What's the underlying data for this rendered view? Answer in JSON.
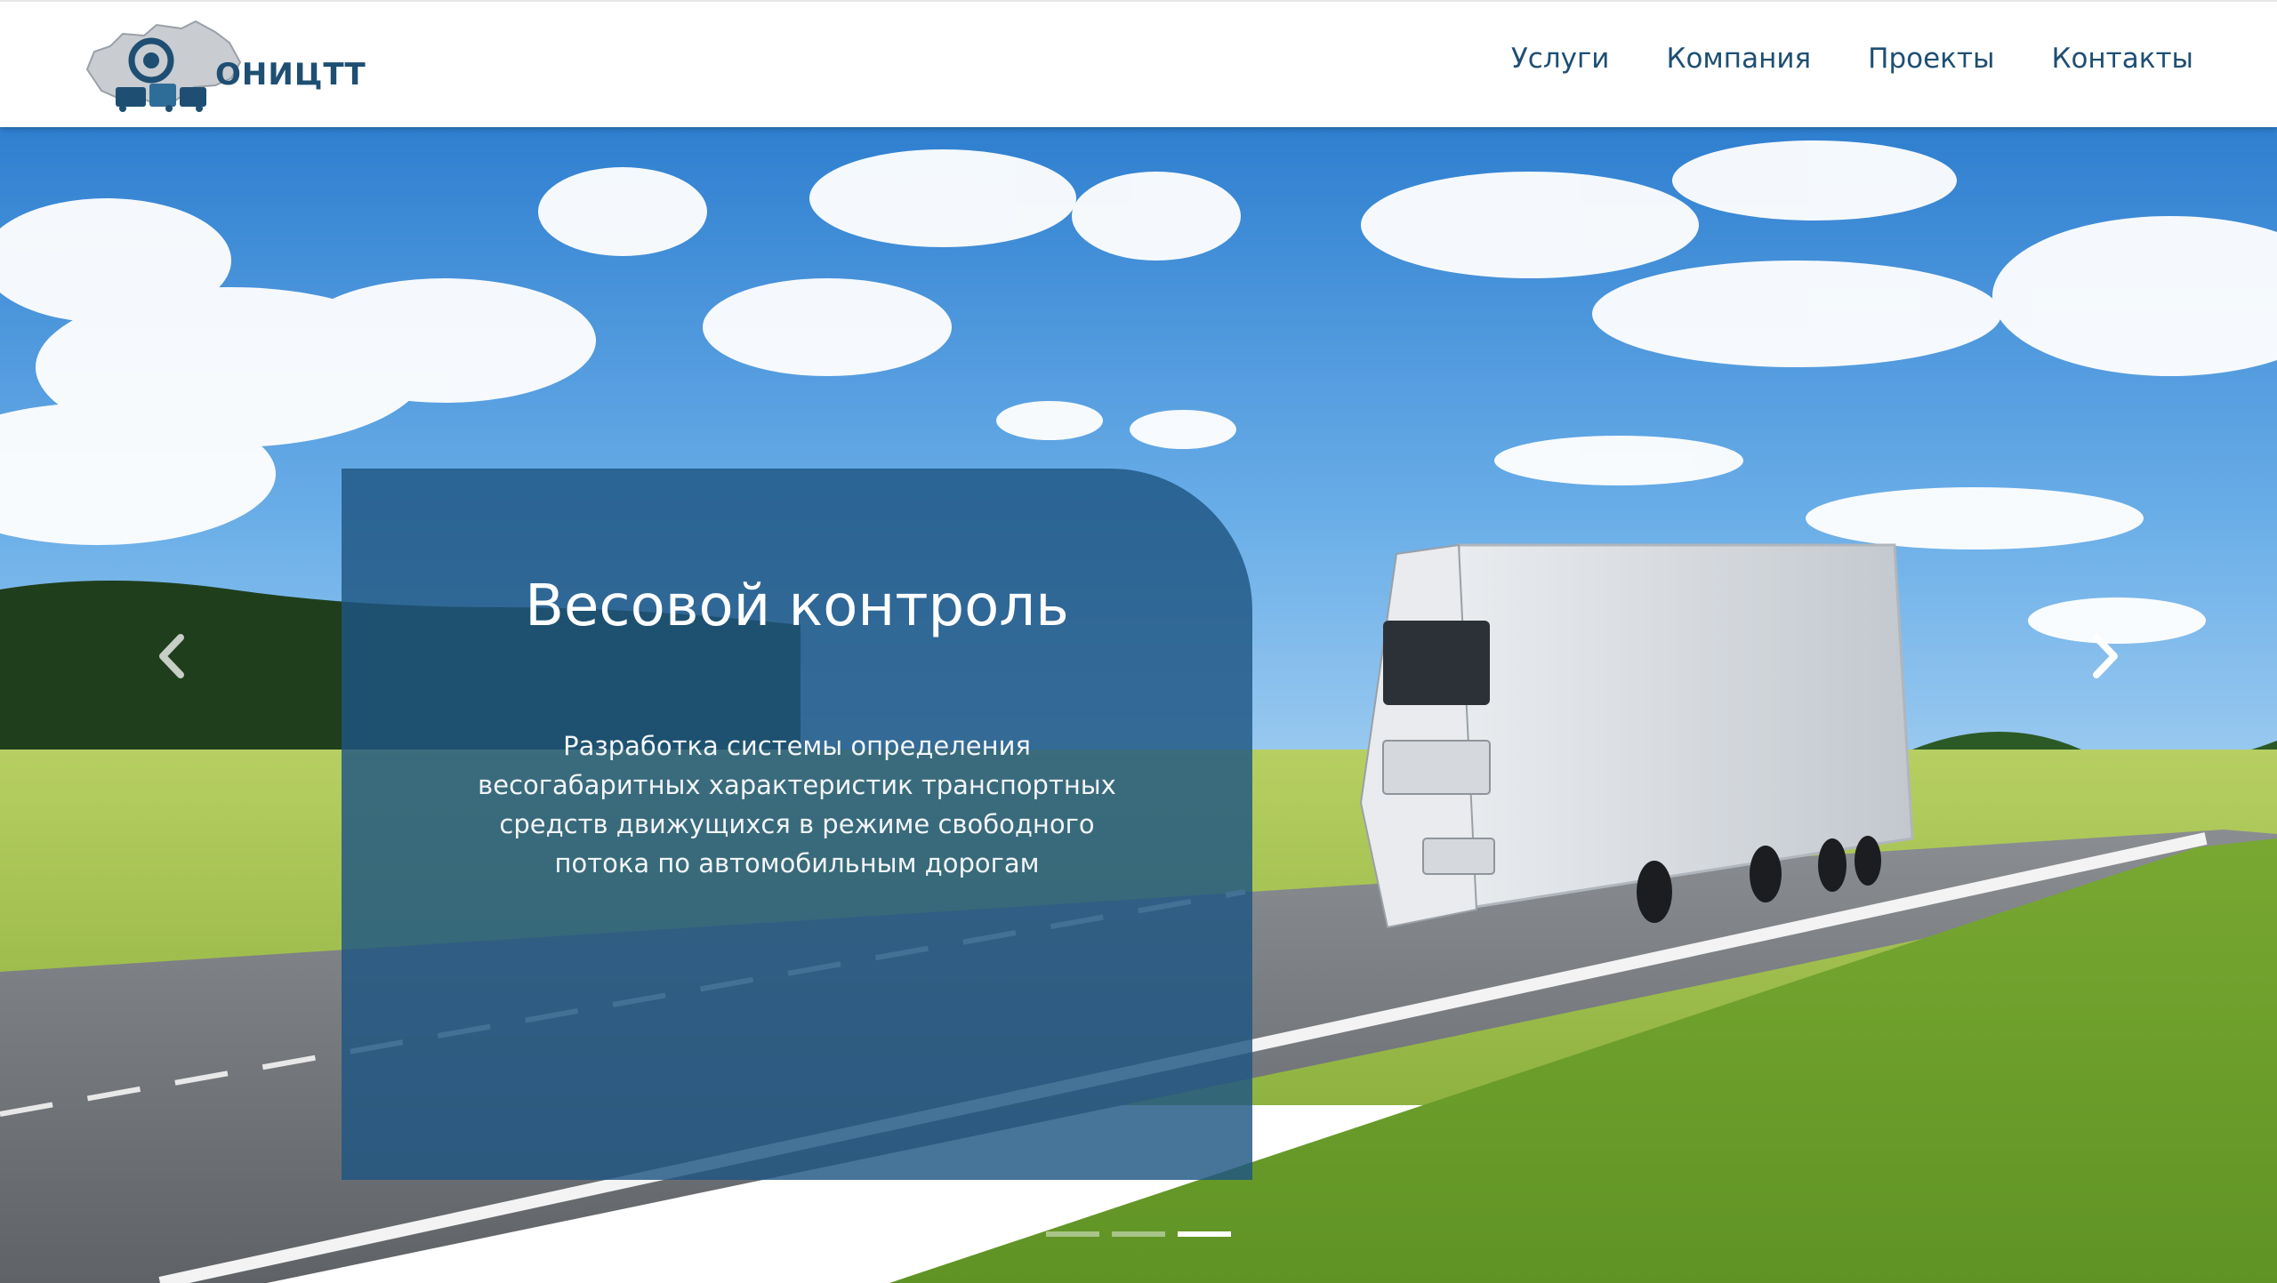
{
  "header": {
    "logo_text": "ОНИЦТТ",
    "nav": [
      {
        "label": "Услуги"
      },
      {
        "label": "Компания"
      },
      {
        "label": "Проекты"
      },
      {
        "label": "Контакты"
      }
    ]
  },
  "slide": {
    "title": "Весовой контроль",
    "text": "Разработка системы определения весогабаритных характеристик транспортных средств движущихся в режиме свободного потока по автомобильным дорогам"
  },
  "carousel": {
    "indicator_count": 3,
    "active_index": 2
  },
  "colors": {
    "brand": "#1e4f73",
    "card": "#1f5682"
  },
  "icons": {
    "prev": "chevron-left-icon",
    "next": "chevron-right-icon"
  }
}
